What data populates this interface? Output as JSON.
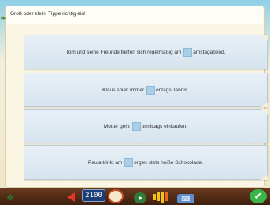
{
  "header": {
    "instruction": "Groß oder klein! Tippe richtig ein!"
  },
  "exercises": [
    {
      "before": "Tom und seine Freunde treffen sich regelmäßig am",
      "after": "amstagabend."
    },
    {
      "before": "Klaus spielt immer",
      "after": "ontags Tennis."
    },
    {
      "before": "Mutter geht",
      "after": "ormittags einkaufen."
    },
    {
      "before": "Paula trinkt am",
      "after": "orgen stets heiße Schokolade."
    }
  ],
  "toolbar": {
    "clock_display": "2100",
    "icons": [
      "plant-icon",
      "back-arrow-icon",
      "clock-display",
      "gauge-icon",
      "help-icon",
      "save-icon",
      "level-bars-icon",
      "keyboard-icon",
      "check-icon"
    ]
  },
  "colors": {
    "paper": "#d7e4ee",
    "gap": "#a9cfe9",
    "toolbar": "#4f2a14",
    "check": "#39b54a"
  }
}
